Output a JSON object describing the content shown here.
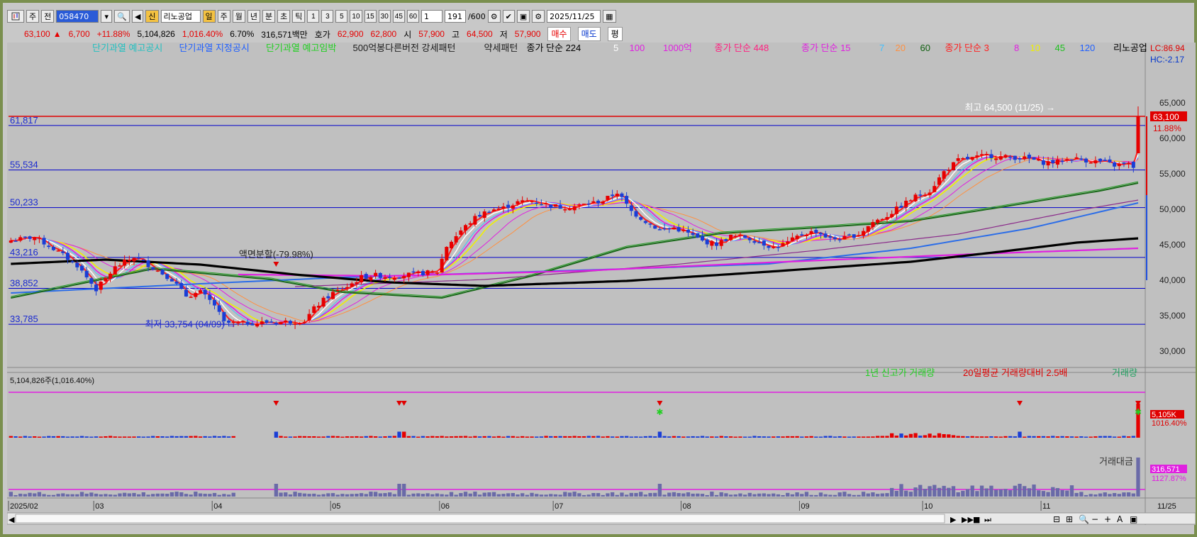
{
  "toolbar": {
    "market": "주",
    "prev": "전",
    "code": "058470",
    "name_badge": "신",
    "stock_name": "리노공업",
    "periods": [
      "일",
      "주",
      "월",
      "년",
      "분",
      "초",
      "틱"
    ],
    "intervals": [
      "1",
      "3",
      "5",
      "10",
      "15",
      "30",
      "45",
      "60"
    ],
    "unit": "1",
    "count": "191",
    "count_total": "/600",
    "date": "2025/11/25"
  },
  "quote": {
    "price": "63,100",
    "change": "6,700",
    "change_pct": "+11.88%",
    "volume": "5,104,826",
    "vol_ratio": "1,016.40%",
    "turnover": "6.70%",
    "amount": "316,571백만",
    "hoga_label": "호가",
    "hoga1": "62,900",
    "hoga2": "62,800",
    "open_label": "시",
    "open": "57,900",
    "high_label": "고",
    "high": "64,500",
    "low_label": "저",
    "low": "57,900",
    "buy_label": "매수",
    "sell_label": "매도",
    "eval_label": "평"
  },
  "colors": {
    "up": "#e60000",
    "down": "#1a3ed6",
    "bg": "#c0c0c0",
    "hline": "#0000cc",
    "resist": "#e00000",
    "ma_black": "#000000",
    "ma_magenta": "#e020e0",
    "ma_dkgreen": "#1a6a1a",
    "ma_blue": "#2b6de8",
    "ma_purple": "#8a2a8a"
  },
  "chart_data": [
    {
      "type": "candlestick",
      "title": "",
      "legend": [
        {
          "text": "단기과열 예고공시",
          "color": "#20c0c0"
        },
        {
          "text": "단기과열 지정공시",
          "color": "#2060ff"
        },
        {
          "text": "단기과열 예고임박",
          "color": "#20d020"
        },
        {
          "text": "500억봉다른버전 강세패턴",
          "color": "#202020"
        },
        {
          "text": "약세패턴",
          "color": "#202020"
        },
        {
          "text": "종가 단순 224",
          "color": "#000000"
        },
        {
          "text": "5",
          "color": "#ffffff"
        },
        {
          "text": "100",
          "color": "#e020e0"
        },
        {
          "text": "1000억",
          "color": "#e020e0"
        },
        {
          "text": "종가 단순 448",
          "color": "#ff2080"
        },
        {
          "text": "종가 단순 15",
          "color": "#e020e0"
        },
        {
          "text": "7",
          "color": "#40c0ff"
        },
        {
          "text": "20",
          "color": "#ff9040"
        },
        {
          "text": "60",
          "color": "#106010"
        },
        {
          "text": "종가 단순 3",
          "color": "#ff2020"
        },
        {
          "text": "8",
          "color": "#e020e0"
        },
        {
          "text": "10",
          "color": "#f0f000"
        },
        {
          "text": "45",
          "color": "#20c020"
        },
        {
          "text": "120",
          "color": "#2060ff"
        },
        {
          "text": "리노공업",
          "color": "#000000"
        }
      ],
      "lc_label": "LC:86.94",
      "hc_label": "HC:-2.17",
      "ylim": [
        28000,
        67500
      ],
      "y_ticks": [
        "65,000",
        "60,000",
        "55,000",
        "50,000",
        "45,000",
        "40,000",
        "35,000",
        "30,000"
      ],
      "y_tick_values": [
        65000,
        60000,
        55000,
        50000,
        45000,
        40000,
        35000,
        30000
      ],
      "price_label": "63,100",
      "price_pct": "11.88%",
      "price_levels": [
        {
          "label": "61,817",
          "value": 61817
        },
        {
          "label": "55,534",
          "value": 55534
        },
        {
          "label": "50,233",
          "value": 50233
        },
        {
          "label": "43,216",
          "value": 43216
        },
        {
          "label": "38,852",
          "value": 38852
        },
        {
          "label": "33,785",
          "value": 33785
        }
      ],
      "resistance": 63100,
      "annotations": [
        {
          "text": "최고 64,500 (11/25) →",
          "value": 64500
        },
        {
          "text": "최저 33,754 (04/09) →",
          "value": 33754
        },
        {
          "text": "액면분할(-79.98%)",
          "value": 43500
        }
      ],
      "x_labels": [
        "2025/02",
        "03",
        "04",
        "05",
        "06",
        "07",
        "08",
        "09",
        "10",
        "11"
      ],
      "x_label_index": [
        0,
        18,
        43,
        68,
        91,
        115,
        142,
        167,
        193,
        218
      ],
      "n_bars": 240,
      "close_points": [
        [
          0,
          45600
        ],
        [
          5,
          46100
        ],
        [
          10,
          44000
        ],
        [
          14,
          42100
        ],
        [
          18,
          38700
        ],
        [
          22,
          41800
        ],
        [
          26,
          43300
        ],
        [
          30,
          41800
        ],
        [
          34,
          40100
        ],
        [
          37,
          37800
        ],
        [
          40,
          38300
        ],
        [
          43,
          36500
        ],
        [
          45,
          34000
        ],
        [
          48,
          33900
        ],
        [
          52,
          34000
        ],
        [
          56,
          34100
        ],
        [
          60,
          34200
        ],
        [
          62,
          34300
        ],
        [
          64,
          36000
        ],
        [
          66,
          37200
        ],
        [
          68,
          38200
        ],
        [
          71,
          39100
        ],
        [
          74,
          40400
        ],
        [
          77,
          40700
        ],
        [
          80,
          40500
        ],
        [
          84,
          40800
        ],
        [
          87,
          41000
        ],
        [
          90,
          41200
        ],
        [
          92,
          44800
        ],
        [
          95,
          47000
        ],
        [
          98,
          48800
        ],
        [
          101,
          49900
        ],
        [
          104,
          50200
        ],
        [
          107,
          51000
        ],
        [
          110,
          51200
        ],
        [
          113,
          50700
        ],
        [
          116,
          50300
        ],
        [
          119,
          50400
        ],
        [
          122,
          50800
        ],
        [
          125,
          51200
        ],
        [
          128,
          52400
        ],
        [
          131,
          49700
        ],
        [
          134,
          48300
        ],
        [
          137,
          47100
        ],
        [
          140,
          47400
        ],
        [
          143,
          46600
        ],
        [
          146,
          45500
        ],
        [
          149,
          45100
        ],
        [
          152,
          46200
        ],
        [
          155,
          46100
        ],
        [
          158,
          45400
        ],
        [
          161,
          44600
        ],
        [
          164,
          45300
        ],
        [
          167,
          46500
        ],
        [
          170,
          46900
        ],
        [
          173,
          45800
        ],
        [
          176,
          45900
        ],
        [
          179,
          46500
        ],
        [
          182,
          48200
        ],
        [
          185,
          49100
        ],
        [
          188,
          50500
        ],
        [
          191,
          51800
        ],
        [
          194,
          52600
        ],
        [
          197,
          55300
        ],
        [
          200,
          56900
        ],
        [
          203,
          57200
        ],
        [
          206,
          57600
        ],
        [
          209,
          57400
        ],
        [
          212,
          57300
        ],
        [
          215,
          57100
        ],
        [
          218,
          56600
        ],
        [
          221,
          56700
        ],
        [
          224,
          57200
        ],
        [
          227,
          56900
        ],
        [
          230,
          56700
        ],
        [
          233,
          56200
        ],
        [
          235,
          56400
        ],
        [
          236,
          56300
        ],
        [
          237,
          56000
        ],
        [
          238,
          63100
        ]
      ],
      "ma224_points": [
        [
          0,
          42300
        ],
        [
          20,
          42900
        ],
        [
          40,
          42200
        ],
        [
          60,
          40800
        ],
        [
          80,
          39700
        ],
        [
          100,
          39200
        ],
        [
          130,
          39900
        ],
        [
          160,
          41200
        ],
        [
          190,
          42600
        ],
        [
          210,
          44100
        ],
        [
          225,
          45300
        ],
        [
          238,
          45900
        ]
      ],
      "ma448_points": [
        [
          48,
          40800
        ],
        [
          80,
          40600
        ],
        [
          120,
          41300
        ],
        [
          160,
          42500
        ],
        [
          200,
          43600
        ],
        [
          238,
          44500
        ]
      ],
      "ma120_points": [
        [
          0,
          38200
        ],
        [
          40,
          39500
        ],
        [
          70,
          40400
        ],
        [
          100,
          41000
        ],
        [
          130,
          41600
        ],
        [
          160,
          42300
        ],
        [
          190,
          44500
        ],
        [
          215,
          47300
        ],
        [
          238,
          50900
        ]
      ],
      "ma60_points": [
        [
          0,
          37700
        ],
        [
          30,
          41800
        ],
        [
          55,
          40300
        ],
        [
          70,
          38500
        ],
        [
          91,
          37700
        ],
        [
          110,
          40800
        ],
        [
          130,
          44800
        ],
        [
          150,
          46800
        ],
        [
          170,
          47600
        ],
        [
          190,
          48500
        ],
        [
          210,
          50600
        ],
        [
          230,
          52800
        ],
        [
          238,
          53900
        ]
      ],
      "ma100_points": [
        [
          60,
          39100
        ],
        [
          100,
          40100
        ],
        [
          140,
          42200
        ],
        [
          170,
          44200
        ],
        [
          200,
          46500
        ],
        [
          225,
          49800
        ],
        [
          238,
          51300
        ]
      ]
    },
    {
      "type": "bar",
      "title": "",
      "legend": [
        {
          "text": "1년 신고가 거래량",
          "color": "#20d020"
        },
        {
          "text": "20일평균 거래량대비 2.5배",
          "color": "#e00000"
        },
        {
          "text": "거래량",
          "color": "#20a060"
        }
      ],
      "header": "5,104,826주(1,016.40%)",
      "last_label": "5,105K",
      "last_pct": "1016.40%",
      "signal_bars": [
        56,
        82,
        83,
        137,
        213,
        238
      ]
    },
    {
      "type": "bar",
      "title": "",
      "legend": [
        {
          "text": "거래대금",
          "color": "#404040"
        }
      ],
      "last_label": "316,571",
      "last_pct": "1127.87%"
    }
  ],
  "bottom_date": "11/25"
}
